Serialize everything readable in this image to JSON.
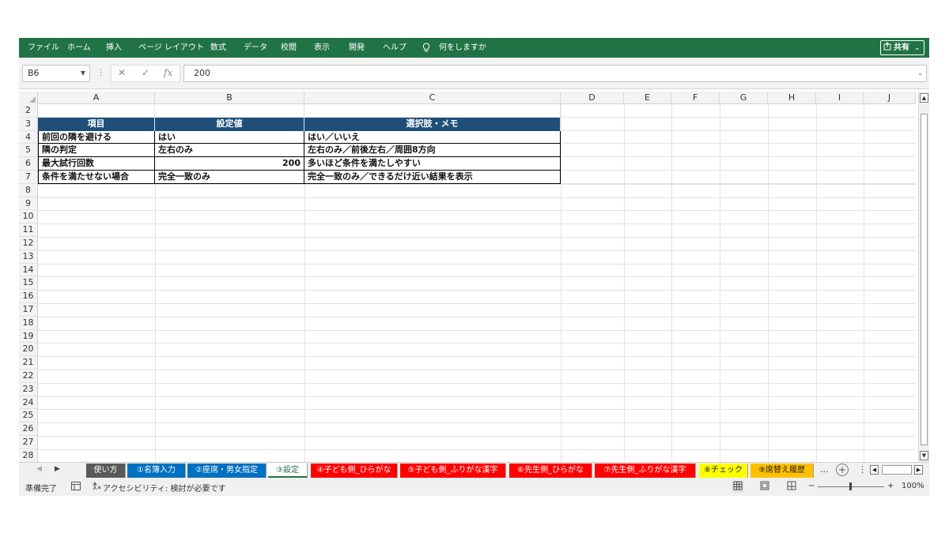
{
  "menu": {
    "items": [
      "ファイル",
      "ホーム",
      "挿入",
      "ページ レイアウト",
      "数式",
      "データ",
      "校閲",
      "表示",
      "開発",
      "ヘルプ",
      "何をしますか"
    ],
    "tell_me_icon": "lightbulb-icon",
    "share_label": "共有",
    "share_icon": "share-icon"
  },
  "formula_bar": {
    "name_box": "B6",
    "cancel_icon": "✕",
    "enter_icon": "✓",
    "fx_label": "fx",
    "value": "200"
  },
  "columns": [
    "A",
    "B",
    "C",
    "D",
    "E",
    "F",
    "G",
    "H",
    "I",
    "J"
  ],
  "rows": [
    "2",
    "3",
    "4",
    "5",
    "6",
    "7",
    "8",
    "9",
    "10",
    "11",
    "12",
    "13",
    "14",
    "15",
    "16",
    "17",
    "18",
    "19",
    "20",
    "21",
    "22",
    "23",
    "24",
    "25",
    "26",
    "27",
    "28"
  ],
  "table": {
    "headers": [
      "項目",
      "設定値",
      "選択肢・メモ"
    ],
    "rows": [
      {
        "a": "前回の隣を避ける",
        "b": "はい",
        "c": "はい／いいえ"
      },
      {
        "a": "隣の判定",
        "b": "左右のみ",
        "c": "左右のみ／前後左右／周囲8方向"
      },
      {
        "a": "最大試行回数",
        "b": "200",
        "c": "多いほど条件を満たしやすい"
      },
      {
        "a": "条件を満たせない場合",
        "b": "完全一致のみ",
        "c": "完全一致のみ／できるだけ近い結果を表示"
      }
    ]
  },
  "sheet_tabs": [
    {
      "label": "使い方",
      "color": "#595959"
    },
    {
      "label": "①名簿入力",
      "color": "#0070c0"
    },
    {
      "label": "②座席・男女指定",
      "color": "#0070c0"
    },
    {
      "label": "③設定",
      "color": "#ffffff",
      "active": true
    },
    {
      "label": "④子ども側_ひらがな",
      "color": "#ff0000"
    },
    {
      "label": "⑤子ども側_ふりがな漢字",
      "color": "#ff0000"
    },
    {
      "label": "⑥先生側_ひらがな",
      "color": "#ff0000"
    },
    {
      "label": "⑦先生側_ふりがな漢字",
      "color": "#ff0000"
    },
    {
      "label": "⑧チェック",
      "color": "#ffff00"
    },
    {
      "label": "⑨席替え履歴",
      "color": "#ffc000"
    }
  ],
  "tab_more": "...",
  "status": {
    "ready": "準備完了",
    "accessibility": "アクセシビリティ: 検討が必要です",
    "zoom_minus": "−",
    "zoom_plus": "+",
    "zoom": "100%"
  }
}
